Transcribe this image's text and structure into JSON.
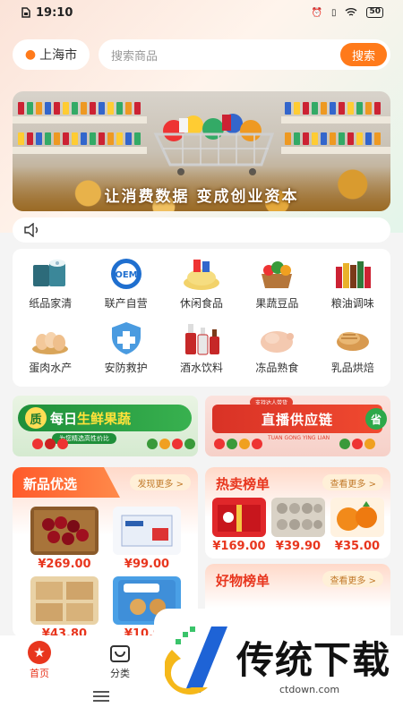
{
  "status_bar": {
    "time": "19:10",
    "battery": "50"
  },
  "header": {
    "location": "上海市",
    "search_placeholder": "搜索商品",
    "search_button": "搜索"
  },
  "banner": {
    "slogan": "让消费数据 变成创业资本"
  },
  "categories": [
    {
      "label": "纸品家清",
      "icon": "tissue-roll-icon"
    },
    {
      "label": "联产自营",
      "icon": "oem-badge-icon"
    },
    {
      "label": "休闲食品",
      "icon": "chips-icon"
    },
    {
      "label": "果蔬豆品",
      "icon": "vegetable-basket-icon"
    },
    {
      "label": "粮油调味",
      "icon": "oil-bottles-icon"
    },
    {
      "label": "蛋肉水产",
      "icon": "eggs-icon"
    },
    {
      "label": "安防救护",
      "icon": "shield-cross-icon"
    },
    {
      "label": "酒水饮料",
      "icon": "bottles-icon"
    },
    {
      "label": "冻品熟食",
      "icon": "chicken-icon"
    },
    {
      "label": "乳品烘焙",
      "icon": "bread-icon"
    }
  ],
  "promos": {
    "left": {
      "badge": "质",
      "title_pre": "每日",
      "title_hl": "生鲜果蔬",
      "subtitle": "为您精选高性价比"
    },
    "right": {
      "tagline": "支持达人带货",
      "title": "直播供应链",
      "badge": "省",
      "pinyin": "TUAN GONG YING LIAN"
    }
  },
  "sections": {
    "new": {
      "title": "新品优选",
      "more": "发现更多 >",
      "products": [
        {
          "price": "¥269.00",
          "icon": "cherries-icon"
        },
        {
          "price": "¥99.00",
          "icon": "box-icon"
        },
        {
          "price": "¥43.80",
          "icon": "biscuits-icon"
        },
        {
          "price": "¥10.90",
          "icon": "cookie-pack-icon"
        }
      ]
    },
    "hot": {
      "title": "热卖榜单",
      "more": "查看更多 >",
      "products": [
        {
          "price": "¥169.00",
          "icon": "gift-box-icon"
        },
        {
          "price": "¥39.90",
          "icon": "eggs-tray-icon"
        },
        {
          "price": "¥35.00",
          "icon": "oranges-icon"
        }
      ]
    },
    "good": {
      "title": "好物榜单",
      "more": "查看更多 >"
    }
  },
  "bottom_nav": [
    {
      "label": "首页",
      "icon": "home-icon",
      "active": true
    },
    {
      "label": "分类",
      "icon": "category-bag-icon",
      "active": false
    }
  ],
  "watermark": {
    "title": "传统下载",
    "url": "ctdown.com"
  },
  "colors": {
    "accent": "#ff7a1a",
    "price": "#e8361e",
    "green": "#2ea84a"
  }
}
